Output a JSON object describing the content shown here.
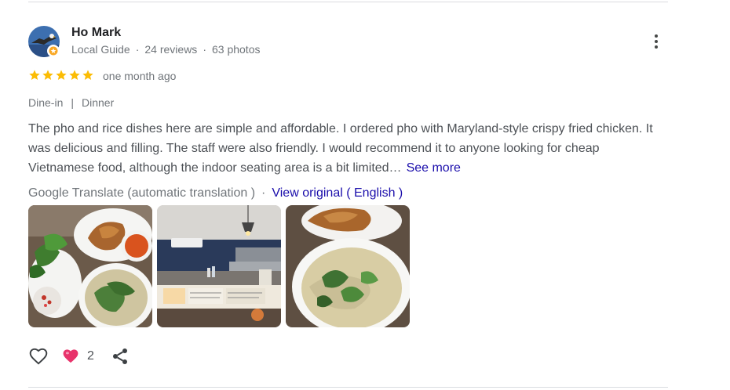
{
  "author": {
    "name": "Ho Mark",
    "badge": "Local Guide",
    "reviews": "24 reviews",
    "photos": "63 photos",
    "meta_separator": "·"
  },
  "rating": {
    "stars": 5,
    "max_stars": 5,
    "color": "#fbbc04"
  },
  "review": {
    "date": "one month ago",
    "tags": [
      "Dine-in",
      "Dinner"
    ],
    "tag_separator": "|",
    "text": "The pho and rice dishes here are simple and affordable. I ordered pho with Maryland-style crispy fried chicken. It was delicious and filling. The staff were also friendly. I would recommend it to anyone looking for cheap Vietnamese food, although the indoor seating area is a bit limited…",
    "see_more": "See more"
  },
  "translation": {
    "label": "Google Translate (automatic translation )",
    "separator": "·",
    "view_original": "View original ( English )"
  },
  "photos": [
    {
      "icon": "pho-with-fried-chicken-photo"
    },
    {
      "icon": "restaurant-counter-photo"
    },
    {
      "icon": "pho-bowl-closeup-photo"
    }
  ],
  "actions": {
    "like_icon": "heart-outline-icon",
    "reaction_icon": "heart-reaction-icon",
    "reaction_count": "2",
    "share_icon": "share-icon"
  },
  "colors": {
    "link": "#1a0dab",
    "secondary_text": "#70757a",
    "body_text": "#4d5156",
    "reaction": "#e8336b"
  }
}
